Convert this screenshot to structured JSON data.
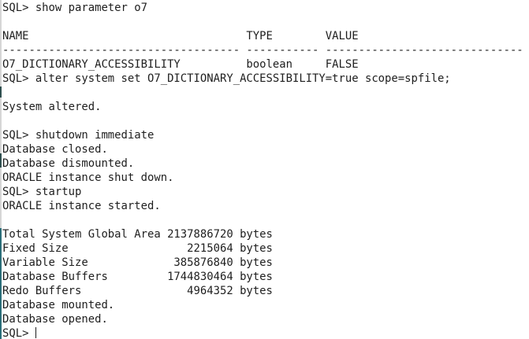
{
  "terminal": {
    "lines": [
      "SQL> show parameter o7",
      "",
      "NAME                                 TYPE        VALUE",
      "------------------------------------ ----------- ------------------------------",
      "O7_DICTIONARY_ACCESSIBILITY          boolean     FALSE",
      "SQL> alter system set O7_DICTIONARY_ACCESSIBILITY=true scope=spfile;",
      "",
      "System altered.",
      "",
      "SQL> shutdown immediate",
      "Database closed.",
      "Database dismounted.",
      "ORACLE instance shut down.",
      "SQL> startup",
      "ORACLE instance started.",
      "",
      "Total System Global Area 2137886720 bytes",
      "Fixed Size                  2215064 bytes",
      "Variable Size             385876840 bytes",
      "Database Buffers         1744830464 bytes",
      "Redo Buffers                4964352 bytes",
      "Database mounted.",
      "Database opened.",
      "SQL> "
    ]
  }
}
